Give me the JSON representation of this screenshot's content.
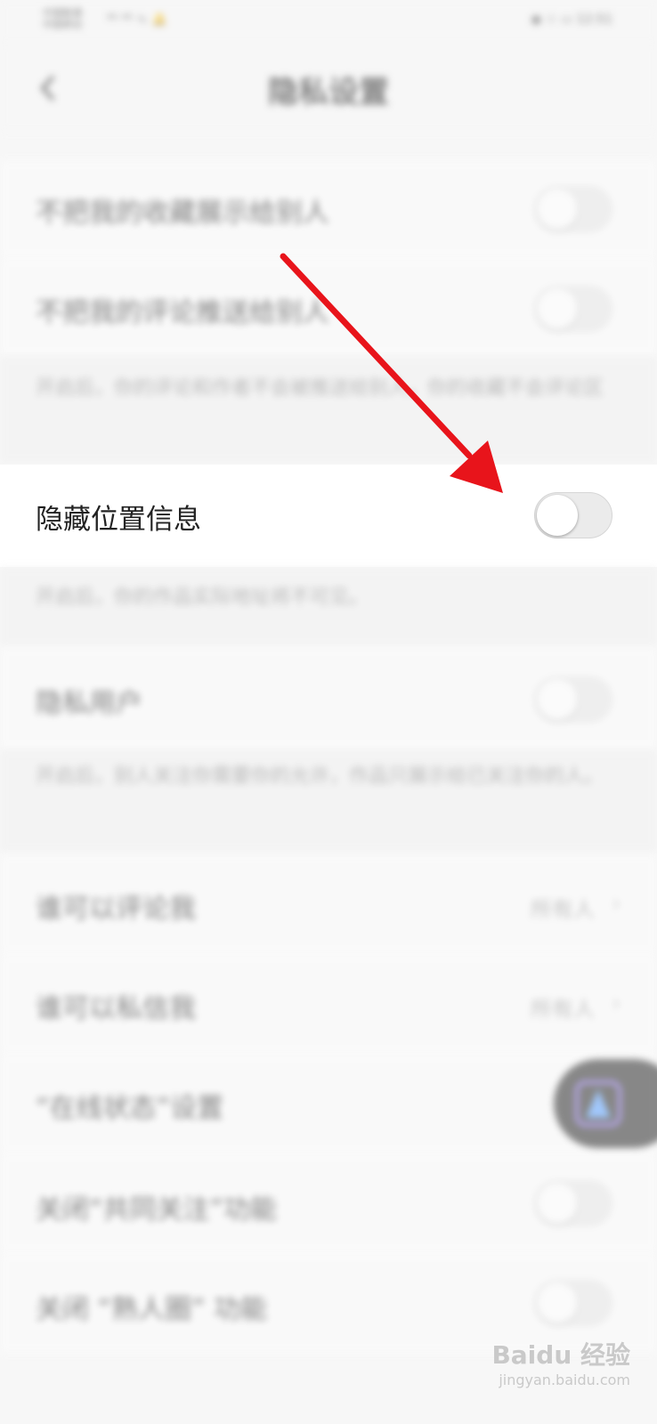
{
  "status_bar": {
    "carrier_line1": "中国联通",
    "carrier_line2": "中国移动",
    "signal": "⁴ᴳ ⁴ᴳ ∿ 🔔",
    "right": "◉ ☆ ▭ 12:51"
  },
  "nav": {
    "back_icon": "chevron-left-icon",
    "title": "隐私设置"
  },
  "rows": [
    {
      "label": "不把我的收藏展示给别人",
      "toggle_on": false
    },
    {
      "label": "不把我的评论推送给别人",
      "toggle_on": false
    }
  ],
  "note_1": "开启后，你的评论和作者不会被推送给别人，你的收藏不会评论区",
  "focus_row": {
    "label": "隐藏位置信息",
    "toggle_on": false
  },
  "note_2": "开启后，你的作品实际地址将不可见。",
  "private_row": {
    "label": "隐私用户",
    "toggle_on": false
  },
  "note_3": "开启后，别人关注你需要你的允许，作品只展示给已关注你的人。",
  "nav_rows": [
    {
      "label": "谁可以评论我",
      "value": "所有人"
    },
    {
      "label": "谁可以私信我",
      "value": "所有人"
    }
  ],
  "online_status_row": {
    "label": "“在线状态”设置"
  },
  "bottom_rows": [
    {
      "label": "关闭“共同关注”功能",
      "toggle_on": false
    },
    {
      "label": "关闭 “熟人圈” 功能",
      "toggle_on": false
    }
  ],
  "floating_button_icon": "assistant-icon",
  "watermark": {
    "text": "Baidu 经验",
    "sub": "jingyan.baidu.com"
  },
  "accent_color": "#e8141b"
}
